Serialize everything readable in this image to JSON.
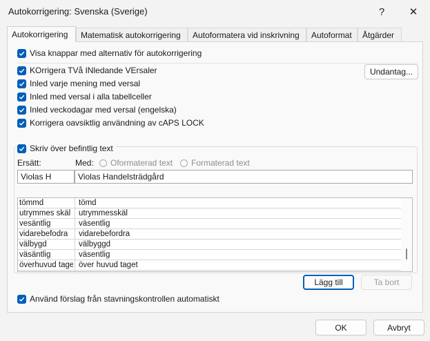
{
  "window": {
    "title": "Autokorrigering: Svenska (Sverige)",
    "help_glyph": "?",
    "close_glyph": "✕"
  },
  "tabs": [
    {
      "label": "Autokorrigering",
      "active": true
    },
    {
      "label": "Matematisk autokorrigering",
      "active": false
    },
    {
      "label": "Autoformatera vid inskrivning",
      "active": false
    },
    {
      "label": "Autoformat",
      "active": false
    },
    {
      "label": "Åtgärder",
      "active": false
    }
  ],
  "options": {
    "show_buttons": {
      "label": "Visa knappar med alternativ för autokorrigering",
      "checked": true
    },
    "two_initials": {
      "label": "KOrrigera TVå INledande VErsaler",
      "checked": true
    },
    "capitalize_sentence": {
      "label": "Inled varje mening med versal",
      "checked": true
    },
    "capitalize_table_cells": {
      "label": "Inled med versal i alla tabellceller",
      "checked": true
    },
    "capitalize_weekdays": {
      "label": "Inled veckodagar med versal (engelska)",
      "checked": true
    },
    "caps_lock": {
      "label": "Korrigera oavsiktlig användning av cAPS LOCK",
      "checked": true
    },
    "replace_text": {
      "label": "Skriv över befintlig text",
      "checked": true
    },
    "use_suggestions": {
      "label": "Använd förslag från stavningskontrollen automatiskt",
      "checked": true
    }
  },
  "buttons": {
    "exceptions": "Undantag...",
    "add": "Lägg till",
    "delete": "Ta bort",
    "ok": "OK",
    "cancel": "Avbryt"
  },
  "replace": {
    "replace_label": "Ersätt:",
    "with_label": "Med:",
    "radio_plain": "Oformaterad text",
    "radio_formatted": "Formaterad text",
    "replace_value": "Violas H",
    "with_value": "Violas Handelsträdgård"
  },
  "entries": [
    {
      "from": "tömmd",
      "to": "tömd"
    },
    {
      "from": "utrymmes skäl",
      "to": "utrymmesskäl"
    },
    {
      "from": "vesäntlig",
      "to": "väsentlig"
    },
    {
      "from": "vidarebefodra",
      "to": "vidarebefordra"
    },
    {
      "from": "välbygd",
      "to": "välbyggd"
    },
    {
      "from": "väsäntlig",
      "to": "väsentlig"
    },
    {
      "from": "överhuvud taget",
      "to": "över huvud taget"
    }
  ],
  "colors": {
    "accent": "#005fb8",
    "window_bg": "#f3f3f3",
    "panel_bg": "#f9f9f9"
  }
}
